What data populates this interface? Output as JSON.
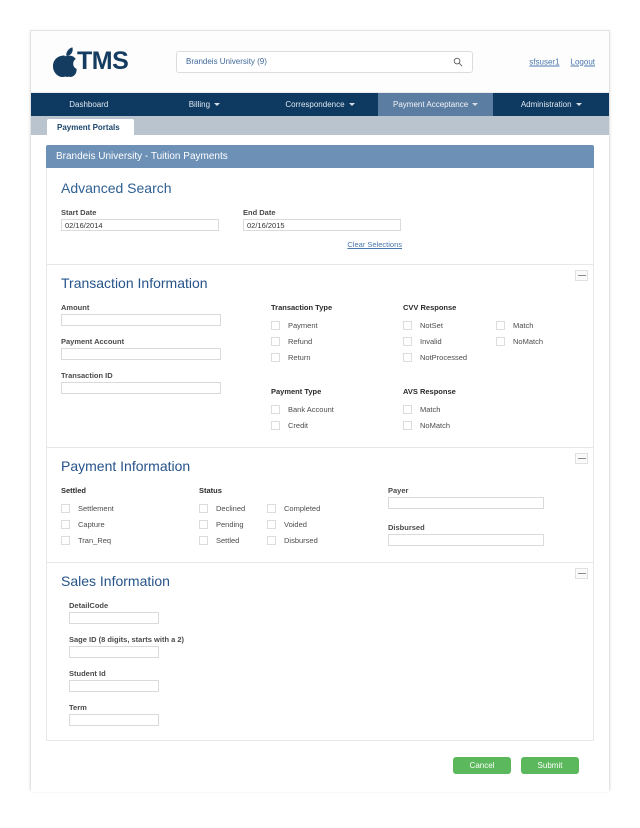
{
  "header": {
    "logo_text": "TMS",
    "logo_icon": "apple-logo-icon",
    "search_value": "Brandeis University (9)",
    "search_icon": "search-icon",
    "user_link": "sfsuser1",
    "logout_link": "Logout"
  },
  "mainnav": [
    {
      "label": "Dashboard",
      "caret": false,
      "active": false
    },
    {
      "label": "Billing",
      "caret": true,
      "active": false
    },
    {
      "label": "Correspondence",
      "caret": true,
      "active": false
    },
    {
      "label": "Payment Acceptance",
      "caret": true,
      "active": true
    },
    {
      "label": "Administration",
      "caret": true,
      "active": false
    }
  ],
  "subnav": {
    "tab_label": "Payment Portals"
  },
  "portal": {
    "title": "Brandeis University - Tuition Payments"
  },
  "advanced_search": {
    "heading": "Advanced Search",
    "start_date_label": "Start Date",
    "start_date_value": "02/16/2014",
    "end_date_label": "End Date",
    "end_date_value": "02/16/2015",
    "clear_link": "Clear Selections"
  },
  "transaction_information": {
    "heading": "Transaction Information",
    "amount_label": "Amount",
    "amount_value": "",
    "payment_account_label": "Payment Account",
    "payment_account_value": "",
    "transaction_id_label": "Transaction ID",
    "transaction_id_value": "",
    "transaction_type_label": "Transaction Type",
    "transaction_type_options": [
      "Payment",
      "Refund",
      "Return"
    ],
    "payment_type_label": "Payment Type",
    "payment_type_options": [
      "Bank Account",
      "Credit"
    ],
    "cvv_response_label": "CVV Response",
    "cvv_response_col1": [
      "NotSet",
      "Invalid",
      "NotProcessed"
    ],
    "cvv_response_col2": [
      "Match",
      "NoMatch"
    ],
    "avs_response_label": "AVS Response",
    "avs_response_options": [
      "Match",
      "NoMatch"
    ]
  },
  "payment_information": {
    "heading": "Payment Information",
    "settled_label": "Settled",
    "settled_options": [
      "Settlement",
      "Capture",
      "Tran_Req"
    ],
    "status_label": "Status",
    "status_col1": [
      "Declined",
      "Pending",
      "Settled"
    ],
    "status_col2": [
      "Completed",
      "Voided",
      "Disbursed"
    ],
    "payer_label": "Payer",
    "payer_value": "",
    "disbursed_label": "Disbursed",
    "disbursed_value": ""
  },
  "sales_information": {
    "heading": "Sales Information",
    "detail_code_label": "DetailCode",
    "detail_code_value": "",
    "sage_id_label": "Sage ID (8 digits, starts with a 2)",
    "sage_id_value": "",
    "student_id_label": "Student Id",
    "student_id_value": "",
    "term_label": "Term",
    "term_value": ""
  },
  "actions": {
    "cancel_label": "Cancel",
    "submit_label": "Submit"
  },
  "colors": {
    "nav_dark": "#0e3a61",
    "nav_active": "#5c7da2",
    "panel_title": "#6c90b6",
    "heading_blue": "#2f5f93",
    "link_blue": "#4a77ad",
    "button_green": "#5cb85c"
  }
}
